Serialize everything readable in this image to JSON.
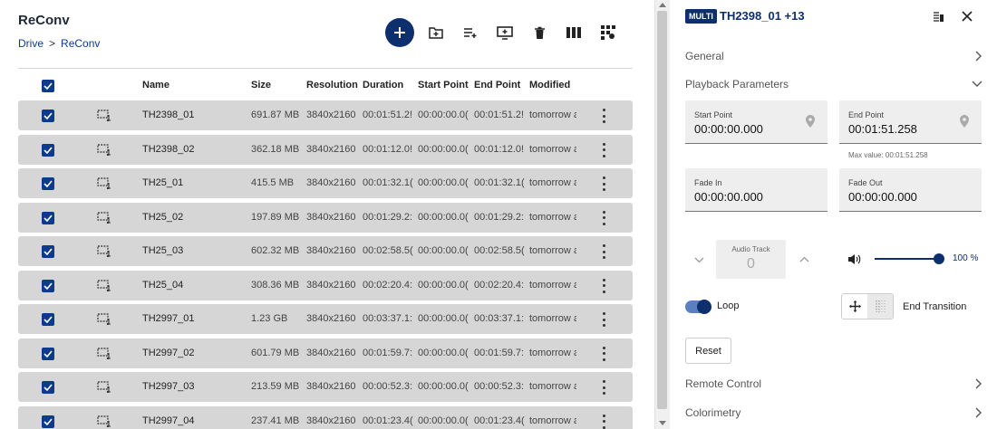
{
  "header": {
    "title": "ReConv",
    "breadcrumb": [
      "Drive",
      "ReConv"
    ]
  },
  "table": {
    "columns": [
      "Name",
      "Size",
      "Resolution",
      "Duration",
      "Start Point",
      "End Point",
      "Modified"
    ],
    "rows": [
      {
        "name": "TH2398_01",
        "size": "691.87 MB",
        "resolution": "3840x2160",
        "duration": "00:01:51.2!",
        "start": "00:00:00.0(",
        "end": "00:01:51.2!",
        "modified": "tomorrow a"
      },
      {
        "name": "TH2398_02",
        "size": "362.18 MB",
        "resolution": "3840x2160",
        "duration": "00:01:12.0!",
        "start": "00:00:00.0(",
        "end": "00:01:12.0!",
        "modified": "tomorrow a"
      },
      {
        "name": "TH25_01",
        "size": "415.5 MB",
        "resolution": "3840x2160",
        "duration": "00:01:32.1(",
        "start": "00:00:00.0(",
        "end": "00:01:32.1(",
        "modified": "tomorrow a"
      },
      {
        "name": "TH25_02",
        "size": "197.89 MB",
        "resolution": "3840x2160",
        "duration": "00:01:29.2:",
        "start": "00:00:00.0(",
        "end": "00:01:29.2:",
        "modified": "tomorrow a"
      },
      {
        "name": "TH25_03",
        "size": "602.32 MB",
        "resolution": "3840x2160",
        "duration": "00:02:58.5(",
        "start": "00:00:00.0(",
        "end": "00:02:58.5(",
        "modified": "tomorrow a"
      },
      {
        "name": "TH25_04",
        "size": "308.36 MB",
        "resolution": "3840x2160",
        "duration": "00:02:20.4:",
        "start": "00:00:00.0(",
        "end": "00:02:20.4:",
        "modified": "tomorrow a"
      },
      {
        "name": "TH2997_01",
        "size": "1.23 GB",
        "resolution": "3840x2160",
        "duration": "00:03:37.1:",
        "start": "00:00:00.0(",
        "end": "00:03:37.1:",
        "modified": "tomorrow a"
      },
      {
        "name": "TH2997_02",
        "size": "601.79 MB",
        "resolution": "3840x2160",
        "duration": "00:01:59.7:",
        "start": "00:00:00.0(",
        "end": "00:01:59.7:",
        "modified": "tomorrow a"
      },
      {
        "name": "TH2997_03",
        "size": "213.59 MB",
        "resolution": "3840x2160",
        "duration": "00:00:52.3:",
        "start": "00:00:00.0(",
        "end": "00:00:52.3:",
        "modified": "tomorrow a"
      },
      {
        "name": "TH2997_04",
        "size": "237.41 MB",
        "resolution": "3840x2160",
        "duration": "00:01:23.4(",
        "start": "00:00:00.0(",
        "end": "00:01:23.4(",
        "modified": "tomorrow a"
      }
    ]
  },
  "panel": {
    "badge": "MULTI",
    "title": "TH2398_01 +13",
    "sections": {
      "general": "General",
      "playback": "Playback Parameters",
      "remote": "Remote Control",
      "colorimetry": "Colorimetry"
    },
    "start_point": {
      "label": "Start Point",
      "value": "00:00:00.000"
    },
    "end_point": {
      "label": "End Point",
      "value": "00:01:51.258"
    },
    "max_value": "Max value: 00:01:51.258",
    "fade_in": {
      "label": "Fade In",
      "value": "00:00:00.000"
    },
    "fade_out": {
      "label": "Fade Out",
      "value": "00:00:00.000"
    },
    "audio_track": {
      "label": "Audio Track",
      "value": "0"
    },
    "volume": {
      "label": "100 %",
      "level": 1.0
    },
    "loop": {
      "label": "Loop",
      "on": true
    },
    "end_transition": "End Transition",
    "reset": "Reset"
  },
  "colors": {
    "accent": "#0d2f6e",
    "row_bg": "#d6d6d6",
    "link": "#0c3b8c"
  }
}
